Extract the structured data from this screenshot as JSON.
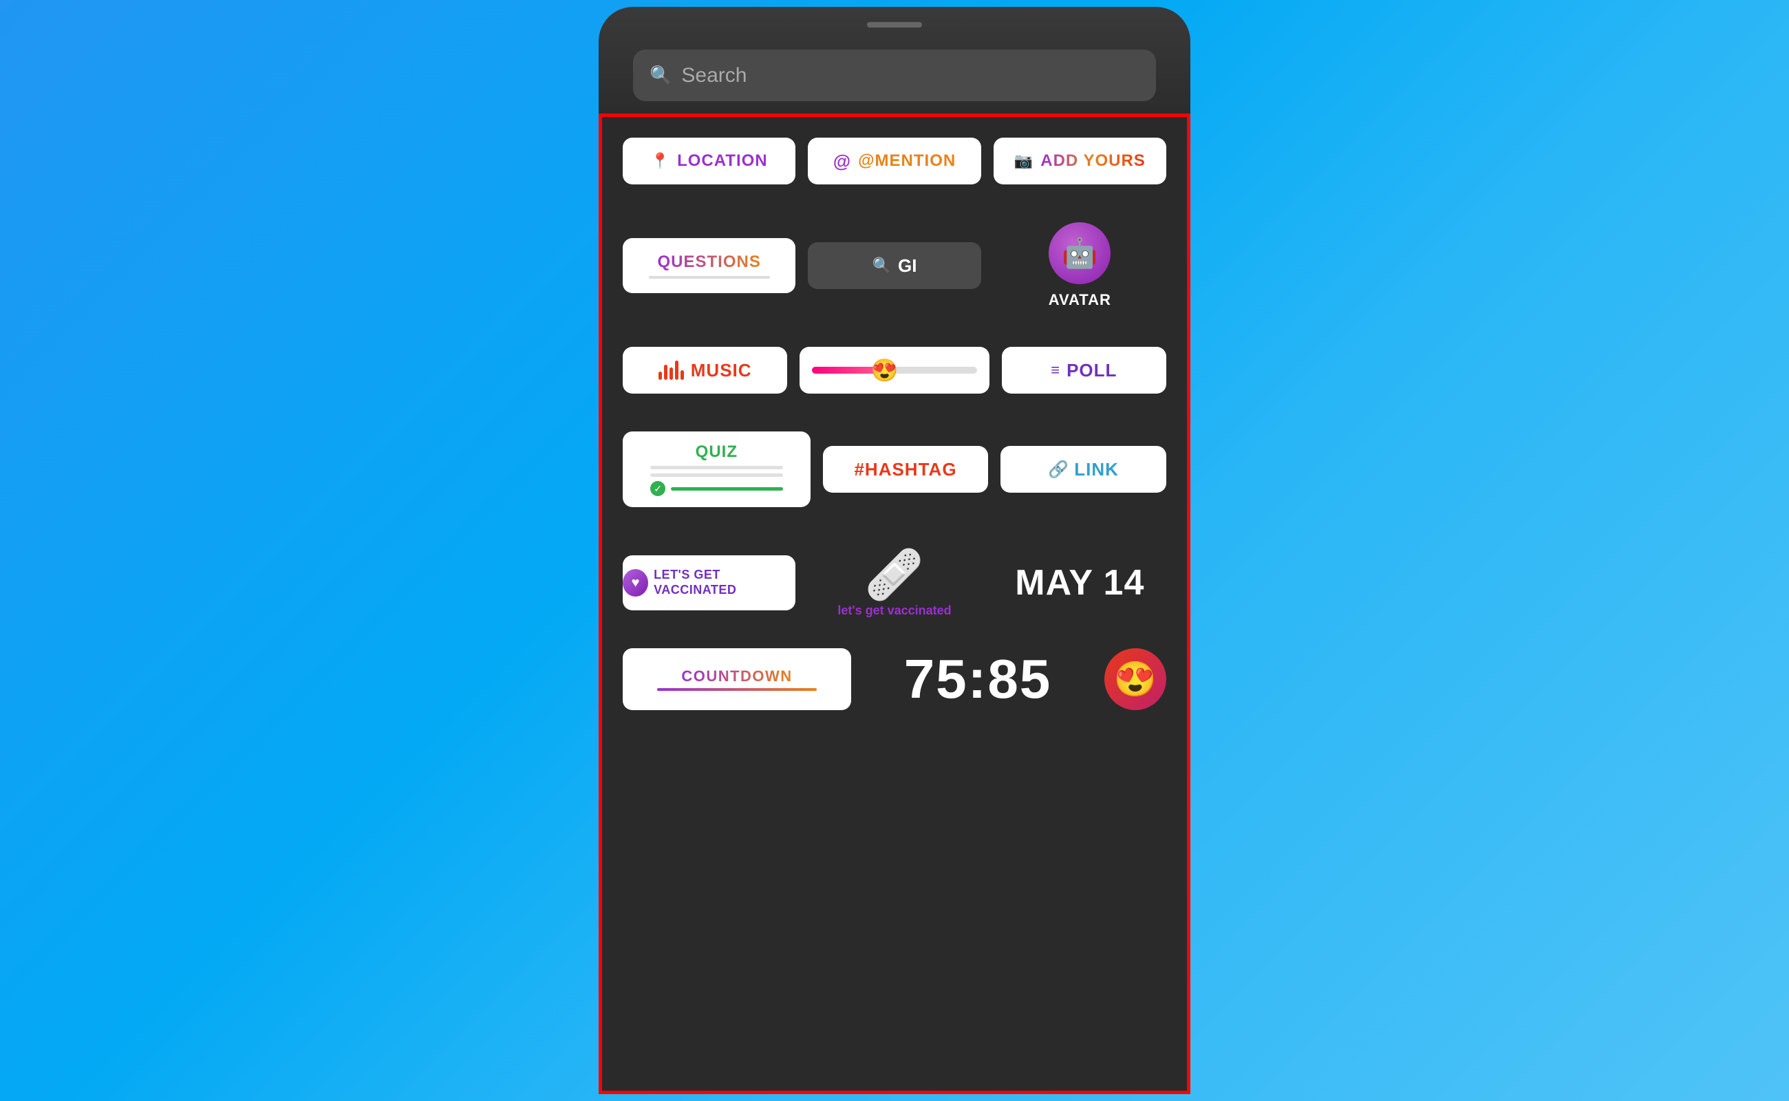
{
  "background": {
    "gradient_start": "#2196F3",
    "gradient_end": "#4FC3F7"
  },
  "search": {
    "placeholder": "Search",
    "icon": "search-icon"
  },
  "stickers": {
    "top_row": [
      {
        "id": "location",
        "label": "LOCATION",
        "icon": "📍",
        "style": "purple"
      },
      {
        "id": "mention",
        "label": "@MENTION",
        "icon": "@",
        "style": "orange"
      },
      {
        "id": "add_yours",
        "label": "ADD YOURS",
        "icon": "📷",
        "style": "gradient"
      }
    ],
    "row2": [
      {
        "id": "questions",
        "label": "QUESTIONS"
      },
      {
        "id": "gif",
        "label": "GI"
      },
      {
        "id": "avatar",
        "label": "AVATAR"
      }
    ],
    "row3": [
      {
        "id": "music",
        "label": "MUSIC"
      },
      {
        "id": "slider",
        "emoji": "😍"
      },
      {
        "id": "poll",
        "label": "POLL"
      }
    ],
    "row4": [
      {
        "id": "quiz",
        "label": "QUIZ"
      },
      {
        "id": "hashtag",
        "label": "#HASHTAG"
      },
      {
        "id": "link",
        "label": "LINK"
      }
    ],
    "row5": [
      {
        "id": "vaccinated",
        "label": "LET'S GET VACCINATED"
      },
      {
        "id": "vacc_sticker",
        "label": "let's get vaccinated",
        "emoji": "🩹"
      },
      {
        "id": "may14",
        "label": "MAY 14"
      }
    ],
    "row6": [
      {
        "id": "countdown",
        "label": "COUNTDOWN"
      },
      {
        "id": "countdown_num",
        "label": "75:85"
      },
      {
        "id": "countdown_emoji",
        "emoji": "😍"
      }
    ]
  }
}
